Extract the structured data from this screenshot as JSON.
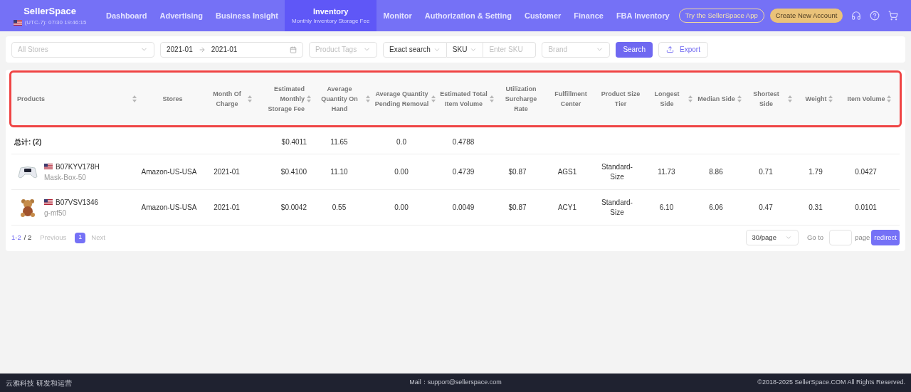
{
  "brand": {
    "logo": "SellerSpace",
    "clock": "(UTC-7): 07/30 19:46:15"
  },
  "nav": [
    {
      "label": "Dashboard",
      "selected": false
    },
    {
      "label": "Advertising",
      "selected": false
    },
    {
      "label": "Business Insight",
      "selected": false
    },
    {
      "label": "Inventory",
      "sublabel": "Monthly Inventory Storage Fee",
      "selected": true
    },
    {
      "label": "Monitor",
      "selected": false
    },
    {
      "label": "Authorization & Setting",
      "selected": false
    },
    {
      "label": "Customer",
      "selected": false
    },
    {
      "label": "Finance",
      "selected": false
    },
    {
      "label": "FBA Inventory",
      "selected": false
    }
  ],
  "header_buttons": {
    "app": "Try the SellerSpace App",
    "create": "Create New Account"
  },
  "filters": {
    "stores": {
      "placeholder": "All Stores"
    },
    "date_from": "2021-01",
    "date_to": "2021-01",
    "tags": {
      "placeholder": "Product Tags"
    },
    "search_mode": "Exact search",
    "search_field": "SKU",
    "sku": {
      "placeholder": "Enter SKU"
    },
    "brand": {
      "placeholder": "Brand"
    },
    "search_button": "Search",
    "export_button": "Export"
  },
  "table": {
    "columns": [
      {
        "label": "Products",
        "sortable": true
      },
      {
        "label": "Stores",
        "sortable": false
      },
      {
        "label": "Month Of Charge",
        "sortable": true
      },
      {
        "label": "Estimated Monthly Storage Fee",
        "sortable": true
      },
      {
        "label": "Average Quantity On Hand",
        "sortable": true
      },
      {
        "label": "Average Quantity Pending Removal",
        "sortable": true
      },
      {
        "label": "Estimated Total Item Volume",
        "sortable": true
      },
      {
        "label": "Utilization Surcharge Rate",
        "sortable": false
      },
      {
        "label": "Fulfillment Center",
        "sortable": false
      },
      {
        "label": "Product Size Tier",
        "sortable": false
      },
      {
        "label": "Longest Side",
        "sortable": true
      },
      {
        "label": "Median Side",
        "sortable": true
      },
      {
        "label": "Shortest Side",
        "sortable": true
      },
      {
        "label": "Weight",
        "sortable": true
      },
      {
        "label": "Item Volume",
        "sortable": true
      }
    ],
    "total": {
      "cells": [
        "总计: (2)",
        "",
        "",
        "$0.4011",
        "11.65",
        "0.0",
        "0.4788",
        "",
        "",
        "",
        "",
        "",
        "",
        "",
        ""
      ]
    },
    "rows": [
      {
        "cells": [
          {
            "asin": "B07KYV178H",
            "sku": "Mask-Box-50"
          },
          "Amazon-US-USA",
          "2021-01",
          "$0.4100",
          "11.10",
          "0.00",
          "0.4739",
          "$0.87",
          "AGS1",
          "Standard-Size",
          "11.73",
          "8.86",
          "0.71",
          "1.79",
          "0.0427"
        ]
      },
      {
        "cells": [
          {
            "asin": "B07VSV1346",
            "sku": "g-mf50"
          },
          "Amazon-US-USA",
          "2021-01",
          "$0.0042",
          "0.55",
          "0.00",
          "0.0049",
          "$0.87",
          "ACY1",
          "Standard-Size",
          "6.10",
          "6.06",
          "0.47",
          "0.31",
          "0.0101"
        ]
      }
    ]
  },
  "pagination": {
    "range": "1-2",
    "total": "/ 2",
    "previous": "Previous",
    "pages": [
      {
        "label": "1",
        "selected": true
      }
    ],
    "next": "Next",
    "page_size": "30/page",
    "goto": "Go to",
    "page": "page",
    "redirect": "redirect"
  },
  "footer": {
    "left": "云雅科技 研发和运营",
    "mail": "Mail：support@sellerspace.com",
    "copyright": "©2018-2025 SellerSpace.COM All Rights Reserved."
  }
}
